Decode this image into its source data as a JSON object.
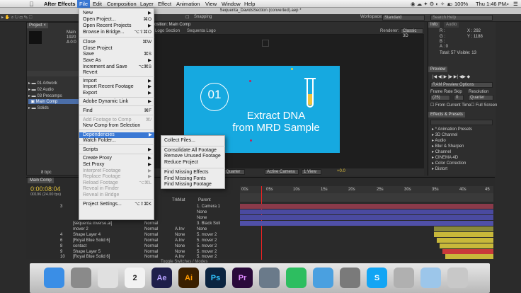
{
  "menubar": {
    "app": "After Effects",
    "items": [
      "File",
      "Edit",
      "Composition",
      "Layer",
      "Effect",
      "Animation",
      "View",
      "Window",
      "Help"
    ],
    "clock": "Thu 1:46 PM",
    "battery": "100%"
  },
  "window_title": "Sequenta_DavidsSection (converted).aep *",
  "toolbar": {
    "snapping": "Snapping",
    "workspace_label": "Workspace:",
    "workspace_value": "Standard",
    "search_placeholder": "Search Help"
  },
  "project_panel": {
    "tab": "Project ×",
    "header_lines": [
      "Main",
      "1920",
      "Δ 0:0"
    ],
    "items": [
      {
        "label": "01 Artwork",
        "selected": false
      },
      {
        "label": "02 Audio",
        "selected": false
      },
      {
        "label": "03 Precomps",
        "selected": false
      },
      {
        "label": "Main Comp",
        "selected": true
      },
      {
        "label": "Solids",
        "selected": false
      }
    ],
    "footer": "8 bpc"
  },
  "comp_panel": {
    "tab1": "osition: Main Comp",
    "tab2": "Logo Section",
    "tab3": "Sequenta Logo",
    "renderer_label": "Renderer:",
    "renderer_value": "Classic 3D",
    "slide_number": "01",
    "slide_title_line1": "Extract DNA",
    "slide_title_line2": "from MRD Sample",
    "footer_quarter": "Quarter",
    "footer_camera": "Active Camera",
    "footer_view": "1 View",
    "footer_offset": "+0.0"
  },
  "info_panel": {
    "tabs": [
      "Info",
      "Audio"
    ],
    "r": "R :",
    "g": "G :",
    "b": "B :",
    "a": "A : 0",
    "x": "X : 292",
    "y": "Y : 1188",
    "total": "Total: 57  Visible: 13"
  },
  "preview_panel": {
    "tab": "Preview",
    "ram_label": "RAM Preview Options",
    "frame_rate_label": "Frame Rate",
    "skip_label": "Skip",
    "resolution_label": "Resolution",
    "frame_rate_value": "(25)",
    "skip_value": "0",
    "resolution_value": "Quarter",
    "from_current": "From Current Time",
    "full_screen": "Full Screen"
  },
  "effects_panel": {
    "tab": "Effects & Presets",
    "items": [
      "* Animation Presets",
      "3D Channel",
      "Audio",
      "Blur & Sharpen",
      "Channel",
      "CINEMA 4D",
      "Color Correction",
      "Distort"
    ]
  },
  "timeline": {
    "tab": "Main Comp",
    "timecode": "0:00:08:04",
    "frames": "00196 (24.00 fps)",
    "col_trkmat": "TrkMat",
    "col_parent": "Parent",
    "ruler": [
      "00s",
      "05s",
      "10s",
      "15s",
      "20s",
      "25s",
      "30s",
      "35s",
      "40s",
      "45"
    ],
    "layers": [
      {
        "num": "3",
        "name": "",
        "mode": "",
        "trk": "",
        "parent": "1. Camera 1"
      },
      {
        "num": "",
        "name": "",
        "mode": "",
        "trk": "",
        "parent": "None"
      },
      {
        "num": "",
        "name": "",
        "mode": "",
        "trk": "",
        "parent": "None"
      },
      {
        "num": "",
        "name": "[sequenta inverse.ai]",
        "mode": "Normal",
        "trk": "",
        "parent": "3. Black Soli"
      },
      {
        "num": "",
        "name": "mover 2",
        "mode": "Normal",
        "trk": "A.Inv",
        "parent": "None"
      },
      {
        "num": "4",
        "name": "Shape Layer 4",
        "mode": "Normal",
        "trk": "None",
        "parent": "5. mover 2"
      },
      {
        "num": "6",
        "name": "[Royal Blue Solid 6]",
        "mode": "Normal",
        "trk": "A.Inv",
        "parent": "5. mover 2"
      },
      {
        "num": "8",
        "name": "contact",
        "mode": "Normal",
        "trk": "None",
        "parent": "5. mover 2"
      },
      {
        "num": "9",
        "name": "Shape Layer 5",
        "mode": "Normal",
        "trk": "None",
        "parent": "5. mover 2"
      },
      {
        "num": "10",
        "name": "[Royal Blue Solid 6]",
        "mode": "Normal",
        "trk": "A.Inv",
        "parent": "5. mover 2"
      }
    ],
    "footer": "Toggle Switches / Modes"
  },
  "file_menu": {
    "items": [
      {
        "label": "New",
        "shortcut": "",
        "state": "normal",
        "arrow": true
      },
      {
        "label": "Open Project...",
        "shortcut": "⌘O",
        "state": "normal",
        "arrow": false
      },
      {
        "label": "Open Recent Projects",
        "shortcut": "",
        "state": "normal",
        "arrow": true
      },
      {
        "label": "Browse in Bridge...",
        "shortcut": "⌥⇧⌘O",
        "state": "normal",
        "arrow": false
      },
      {
        "label": "Close",
        "shortcut": "⌘W",
        "state": "normal",
        "arrow": false
      },
      {
        "label": "Close Project",
        "shortcut": "",
        "state": "normal",
        "arrow": false
      },
      {
        "label": "Save",
        "shortcut": "⌘S",
        "state": "normal",
        "arrow": false
      },
      {
        "label": "Save As",
        "shortcut": "",
        "state": "normal",
        "arrow": true
      },
      {
        "label": "Increment and Save",
        "shortcut": "⌥⌘S",
        "state": "normal",
        "arrow": false
      },
      {
        "label": "Revert",
        "shortcut": "",
        "state": "normal",
        "arrow": false
      },
      {
        "label": "Import",
        "shortcut": "",
        "state": "normal",
        "arrow": true
      },
      {
        "label": "Import Recent Footage",
        "shortcut": "",
        "state": "normal",
        "arrow": true
      },
      {
        "label": "Export",
        "shortcut": "",
        "state": "normal",
        "arrow": true
      },
      {
        "label": "Adobe Dynamic Link",
        "shortcut": "",
        "state": "normal",
        "arrow": true
      },
      {
        "label": "Find",
        "shortcut": "⌘F",
        "state": "normal",
        "arrow": false
      },
      {
        "label": "Add Footage to Comp",
        "shortcut": "⌘/",
        "state": "disabled",
        "arrow": false
      },
      {
        "label": "New Comp from Selection",
        "shortcut": "",
        "state": "normal",
        "arrow": false
      },
      {
        "label": "Dependencies",
        "shortcut": "",
        "state": "highlight",
        "arrow": true
      },
      {
        "label": "Watch Folder...",
        "shortcut": "",
        "state": "normal",
        "arrow": false
      },
      {
        "label": "Scripts",
        "shortcut": "",
        "state": "normal",
        "arrow": true
      },
      {
        "label": "Create Proxy",
        "shortcut": "",
        "state": "normal",
        "arrow": true
      },
      {
        "label": "Set Proxy",
        "shortcut": "",
        "state": "normal",
        "arrow": true
      },
      {
        "label": "Interpret Footage",
        "shortcut": "",
        "state": "disabled",
        "arrow": true
      },
      {
        "label": "Replace Footage",
        "shortcut": "",
        "state": "disabled",
        "arrow": true
      },
      {
        "label": "Reload Footage",
        "shortcut": "⌥⌘L",
        "state": "disabled",
        "arrow": false
      },
      {
        "label": "Reveal in Finder",
        "shortcut": "",
        "state": "disabled",
        "arrow": false
      },
      {
        "label": "Reveal in Bridge",
        "shortcut": "",
        "state": "disabled",
        "arrow": false
      },
      {
        "label": "Project Settings...",
        "shortcut": "⌥⇧⌘K",
        "state": "normal",
        "arrow": false
      }
    ]
  },
  "dependencies_submenu": {
    "items": [
      "Collect Files...",
      "Consolidate All Footage",
      "Remove Unused Footage",
      "Reduce Project",
      "Find Missing Effects",
      "Find Missing Fonts",
      "Find Missing Footage"
    ]
  },
  "dock": {
    "apps": [
      {
        "name": "finder-icon",
        "label": "",
        "color": "#3a8ee6"
      },
      {
        "name": "launchpad-icon",
        "label": "",
        "color": "#8a8a8a"
      },
      {
        "name": "chrome-icon",
        "label": "",
        "color": "#e0e0e0"
      },
      {
        "name": "calendar-icon",
        "label": "2",
        "color": "#f2f2f2"
      },
      {
        "name": "after-effects-icon",
        "label": "Ae",
        "color": "#1f1f4a"
      },
      {
        "name": "illustrator-icon",
        "label": "Ai",
        "color": "#3a1f00"
      },
      {
        "name": "photoshop-icon",
        "label": "Ps",
        "color": "#0b2440"
      },
      {
        "name": "premiere-icon",
        "label": "Pr",
        "color": "#2a0a3a"
      },
      {
        "name": "contacts-icon",
        "label": "",
        "color": "#6a7a8a"
      },
      {
        "name": "evernote-icon",
        "label": "",
        "color": "#2dbe60"
      },
      {
        "name": "app-store-icon",
        "label": "",
        "color": "#4aa0e0"
      },
      {
        "name": "system-preferences-icon",
        "label": "",
        "color": "#7a7a7a"
      },
      {
        "name": "skype-icon",
        "label": "S",
        "color": "#12a5f4"
      },
      {
        "name": "downloads-icon",
        "label": "",
        "color": "#b0b0b0"
      },
      {
        "name": "folder-icon",
        "label": "",
        "color": "#9cc6ea"
      },
      {
        "name": "trash-icon",
        "label": "",
        "color": "#c8c8c8"
      }
    ]
  }
}
